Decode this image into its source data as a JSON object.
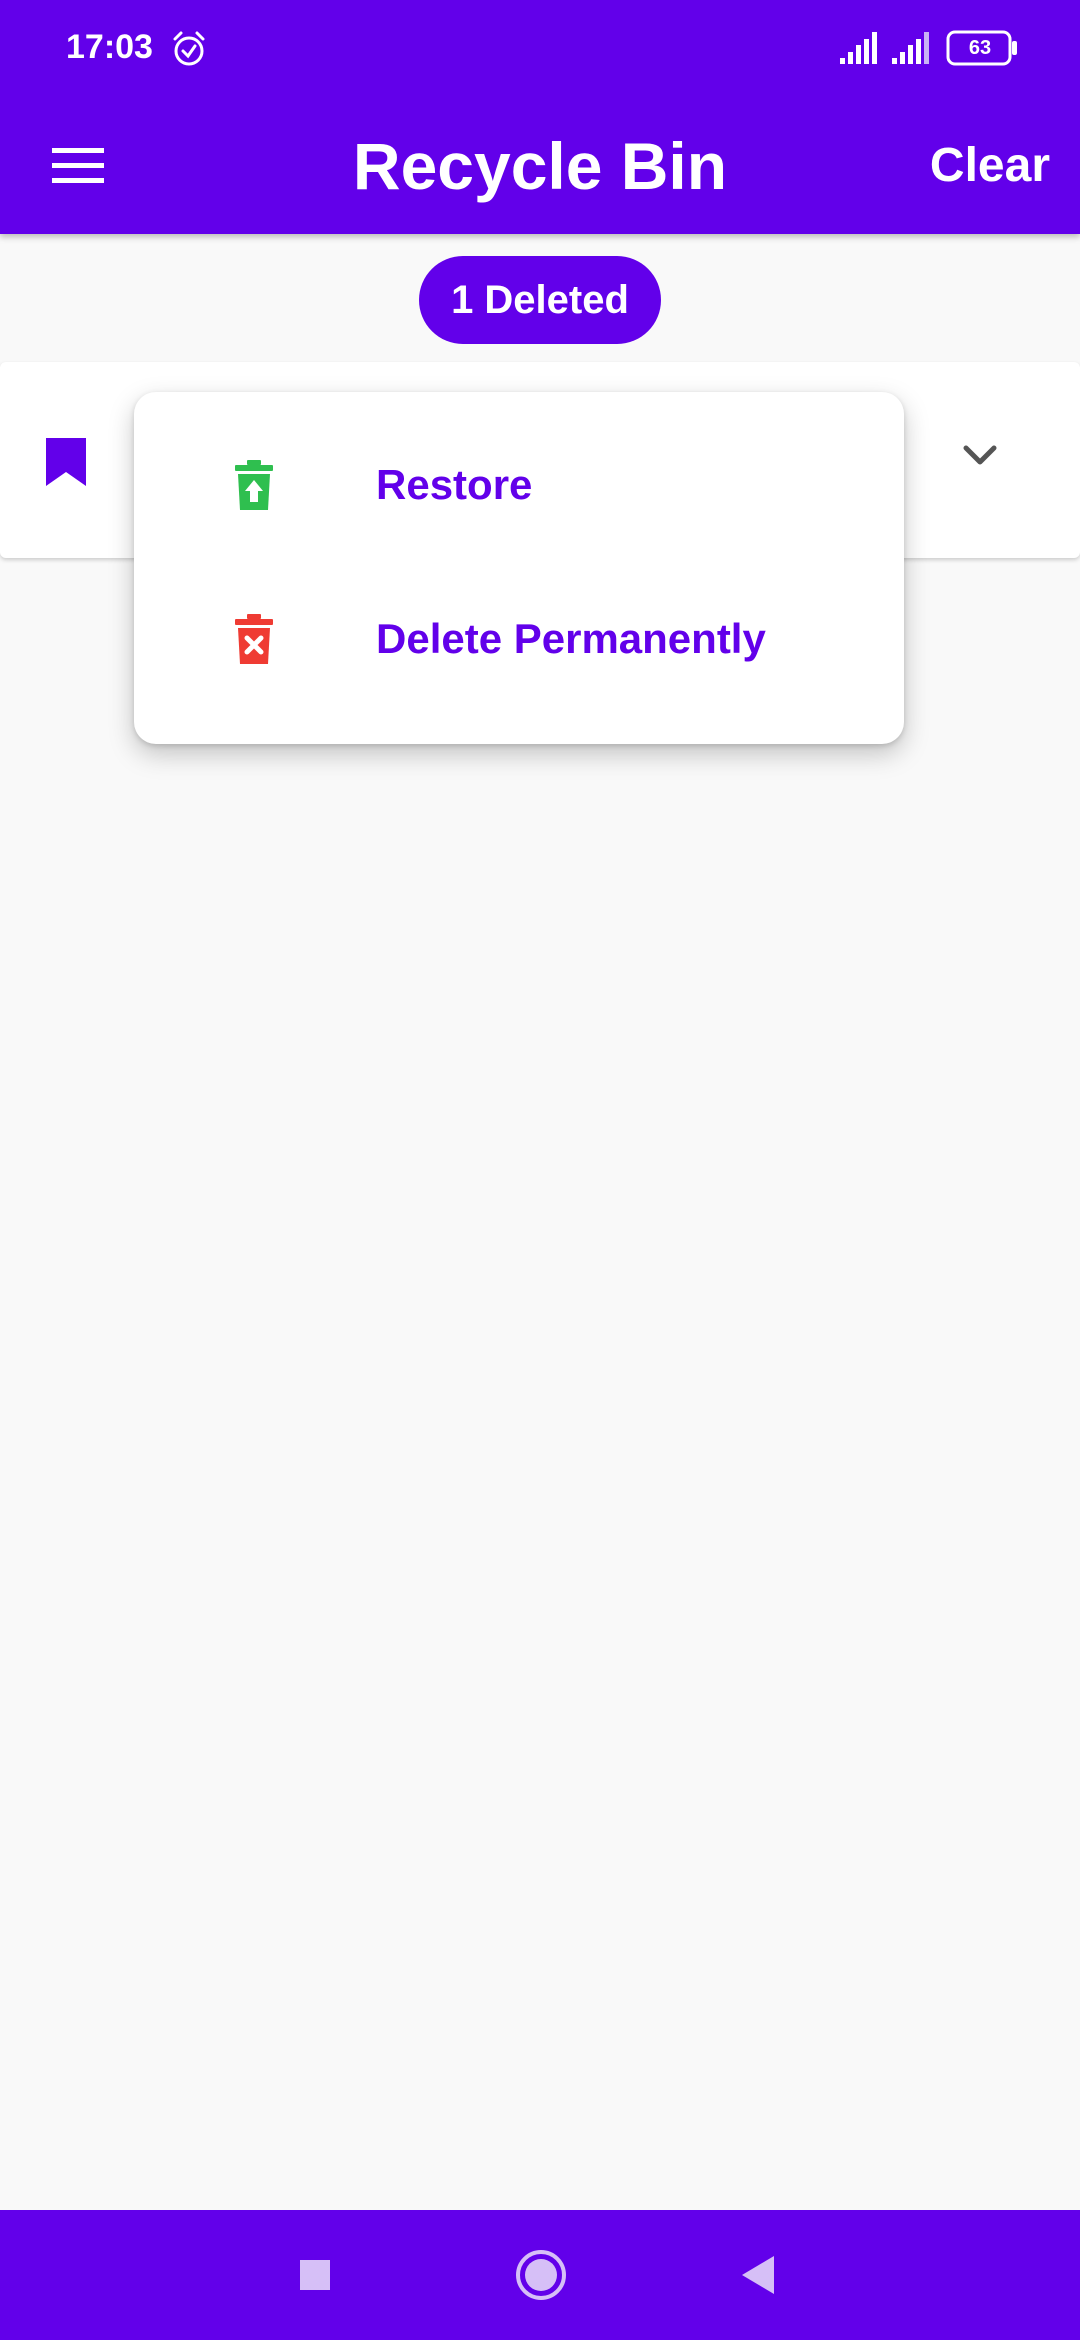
{
  "status_bar": {
    "time": "17:03",
    "battery_level": "63"
  },
  "app_bar": {
    "title": "Recycle Bin",
    "clear_label": "Clear"
  },
  "badge": {
    "deleted_count": "1 Deleted"
  },
  "popup_menu": {
    "items": [
      {
        "label": "Restore",
        "icon": "trash-restore-icon",
        "icon_color": "#2fbf4f"
      },
      {
        "label": "Delete Permanently",
        "icon": "trash-delete-icon",
        "icon_color": "#ef3b33"
      }
    ]
  },
  "colors": {
    "primary": "#6200ea",
    "background": "#f9f9f9",
    "restore": "#2fbf4f",
    "delete": "#ef3b33"
  }
}
